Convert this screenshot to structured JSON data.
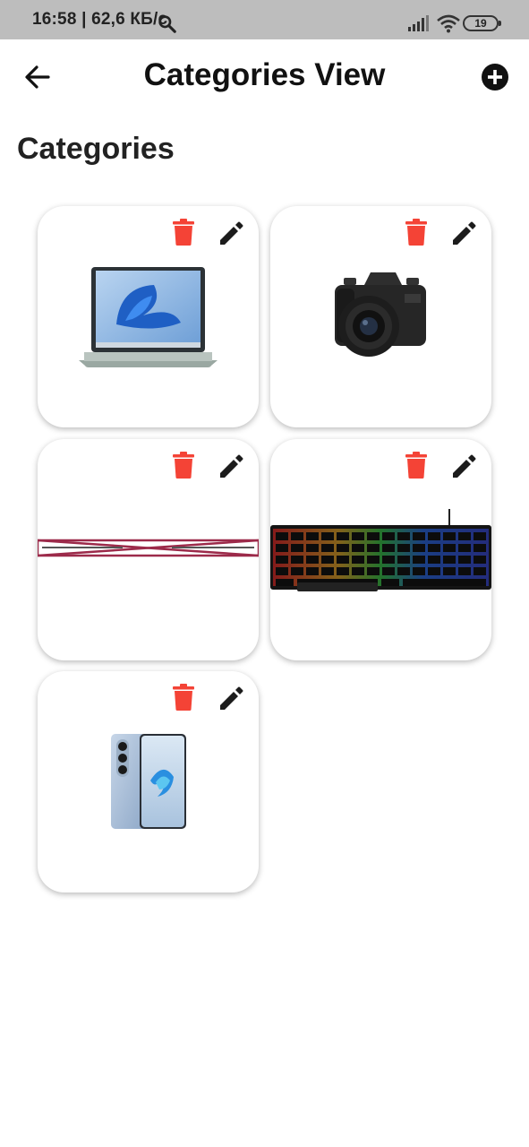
{
  "status_bar": {
    "time": "16:58 | 62,6 КБ/с",
    "battery": "19",
    "icons": [
      "search-icon",
      "signal-icon",
      "wifi-icon",
      "battery-icon"
    ]
  },
  "app_bar": {
    "title": "Categories View",
    "back_icon": "arrow-back-icon",
    "add_icon": "add-circle-icon"
  },
  "section": {
    "title": "Categories"
  },
  "categories": [
    {
      "image": "laptop",
      "delete_icon": "delete-icon",
      "edit_icon": "edit-icon"
    },
    {
      "image": "camera",
      "delete_icon": "delete-icon",
      "edit_icon": "edit-icon"
    },
    {
      "image": "broken-image-banner",
      "delete_icon": "delete-icon",
      "edit_icon": "edit-icon"
    },
    {
      "image": "keyboard",
      "delete_icon": "delete-icon",
      "edit_icon": "edit-icon"
    },
    {
      "image": "smartphone",
      "delete_icon": "delete-icon",
      "edit_icon": "edit-icon"
    }
  ],
  "colors": {
    "status_bar": "#bdbdbd",
    "delete": "#f44336",
    "edit": "#1c1c1c",
    "background": "#ffffff"
  }
}
